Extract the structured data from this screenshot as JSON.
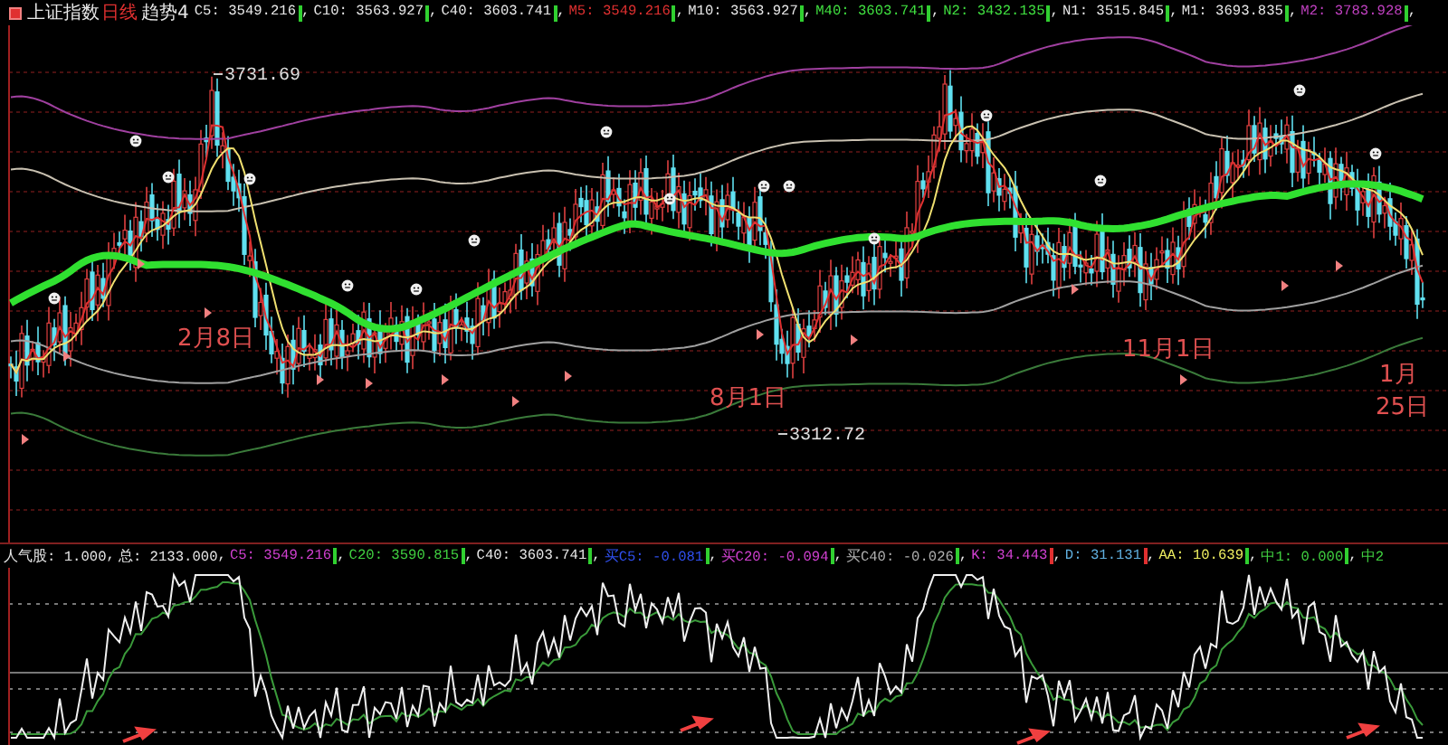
{
  "header": {
    "title": "上证指数",
    "period": "日线",
    "indicator": "趋势4",
    "values": [
      {
        "text": "C5: 3549.216",
        "rising": false,
        "separator": ",",
        "color": "#e8e8e8"
      },
      {
        "text": "C10: 3563.927",
        "rising": false,
        "separator": ",",
        "color": "#e8e8e8"
      },
      {
        "text": "C40: 3603.741",
        "rising": false,
        "separator": ",",
        "color": "#e8e8e8"
      },
      {
        "text": "M5: 3549.216",
        "rising": false,
        "separator": ",",
        "color": "#e03030"
      },
      {
        "text": "M10: 3563.927",
        "rising": false,
        "separator": ",",
        "color": "#e8e8e8"
      },
      {
        "text": "M40: 3603.741",
        "rising": false,
        "separator": ",",
        "color": "#40e040"
      },
      {
        "text": "N2: 3432.135",
        "rising": false,
        "separator": ",",
        "color": "#40e040"
      },
      {
        "text": "N1: 3515.845",
        "rising": false,
        "separator": ",",
        "color": "#e8e8e8"
      },
      {
        "text": "M1: 3693.835",
        "rising": false,
        "separator": ",",
        "color": "#e8e8e8"
      },
      {
        "text": "M2: 3783.928",
        "rising": false,
        "separator": ",",
        "color": "#c040c0"
      }
    ]
  },
  "main_chart": {
    "annotations": [
      {
        "kind": "high",
        "text": "3731.69"
      },
      {
        "kind": "low",
        "text": "3312.72"
      },
      {
        "kind": "date",
        "lines": [
          "2月8日"
        ]
      },
      {
        "kind": "date",
        "lines": [
          "8月1日"
        ]
      },
      {
        "kind": "date",
        "lines": [
          "11月1日"
        ]
      },
      {
        "kind": "date",
        "lines": [
          "1月",
          "25日"
        ]
      }
    ]
  },
  "indicator_header": {
    "values": [
      {
        "text": "人气股: 1.000",
        "separator": ",",
        "color": "#e8e8e8"
      },
      {
        "text": "总: 2133.000",
        "separator": ",",
        "color": "#e8e8e8"
      },
      {
        "text": "C5: 3549.216",
        "rising": false,
        "separator": ",",
        "color": "#d040d0"
      },
      {
        "text": "C20: 3590.815",
        "rising": false,
        "separator": ",",
        "color": "#40d040"
      },
      {
        "text": "C40: 3603.741",
        "rising": false,
        "separator": ",",
        "color": "#e8e8e8"
      },
      {
        "text": "买C5: -0.081",
        "rising": false,
        "separator": ",",
        "color": "#3050f0"
      },
      {
        "text": "买C20: -0.094",
        "rising": false,
        "separator": ",",
        "color": "#d040d0"
      },
      {
        "text": "买C40: -0.026",
        "rising": false,
        "separator": ",",
        "color": "#b0b0b0"
      },
      {
        "text": "K: 34.443",
        "rising": true,
        "separator": ",",
        "color": "#d040d0"
      },
      {
        "text": "D: 31.131",
        "rising": true,
        "separator": ",",
        "color": "#60b0e0"
      },
      {
        "text": "AA: 10.639",
        "rising": false,
        "separator": ",",
        "color": "#f0f060"
      },
      {
        "text": "中1: 0.000",
        "rising": false,
        "separator": ",",
        "color": "#40d040"
      },
      {
        "text": "中2",
        "color": "#40d040"
      }
    ]
  }
}
